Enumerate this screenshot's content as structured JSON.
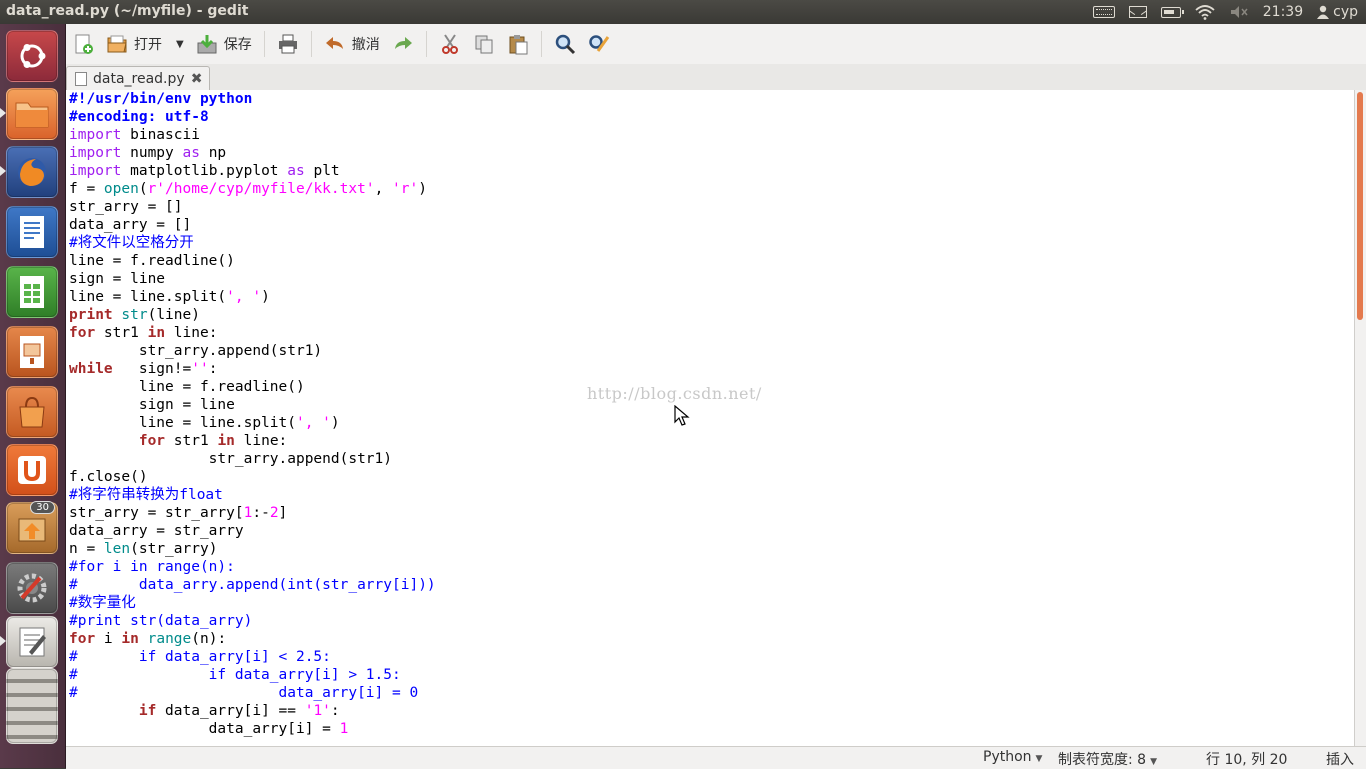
{
  "window": {
    "title": "data_read.py (~/myfile) - gedit"
  },
  "panel": {
    "time": "21:39",
    "user": "cyp"
  },
  "launcher": {
    "items": [
      {
        "name": "ubuntu-dash-icon"
      },
      {
        "name": "files-icon"
      },
      {
        "name": "firefox-icon"
      },
      {
        "name": "writer-icon"
      },
      {
        "name": "calc-icon"
      },
      {
        "name": "impress-icon"
      },
      {
        "name": "software-center-icon"
      },
      {
        "name": "ubuntu-one-icon"
      },
      {
        "name": "updates-icon",
        "badge": "30"
      },
      {
        "name": "settings-icon"
      },
      {
        "name": "gedit-icon"
      },
      {
        "name": "workspace-switcher-icon"
      }
    ]
  },
  "toolbar": {
    "open_label": "打开",
    "save_label": "保存",
    "undo_label": "撤消"
  },
  "tab": {
    "label": "data_read.py"
  },
  "code": {
    "lines": [
      "#!/usr/bin/env python",
      "#encoding: utf-8",
      "import binascii",
      "import numpy as np",
      "import matplotlib.pyplot as plt",
      "f = open(r'/home/cyp/myfile/kk.txt', 'r')",
      "str_arry = []",
      "data_arry = []",
      "#将文件以空格分开",
      "line = f.readline()",
      "sign = line",
      "line = line.split(', ')",
      "print str(line)",
      "for str1 in line:",
      "        str_arry.append(str1)",
      "while   sign!='':",
      "        line = f.readline()",
      "        sign = line",
      "        line = line.split(', ')",
      "        for str1 in line:",
      "                str_arry.append(str1)",
      "f.close()",
      "#将字符串转换为float",
      "str_arry = str_arry[1:-2]",
      "data_arry = str_arry",
      "n = len(str_arry)",
      "#for i in range(n):",
      "#       data_arry.append(int(str_arry[i]))",
      "#数字量化",
      "#print str(data_arry)",
      "for i in range(n):",
      "#       if data_arry[i] < 2.5:",
      "#               if data_arry[i] > 1.5:",
      "#                       data_arry[i] = 0",
      "        if data_arry[i] == '1':",
      "                data_arry[i] = 1"
    ]
  },
  "watermark": "http://blog.csdn.net/",
  "status": {
    "language": "Python",
    "tab_width": "制表符宽度: 8",
    "position": "行 10, 列 20",
    "mode": "插入"
  },
  "colors": {
    "keyword": "#a52a2a",
    "import": "#a020f0",
    "builtin": "#008b8b",
    "string": "#ff00ff",
    "comment": "#0000ff",
    "accent": "#e47a4e"
  }
}
